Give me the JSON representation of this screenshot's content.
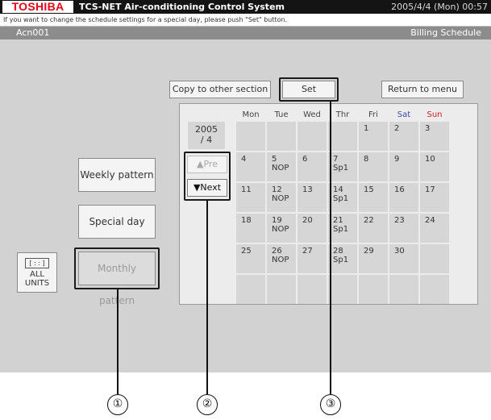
{
  "titlebar": {
    "logo": "TOSHIBA",
    "title": "TCS-NET Air-conditioning Control System",
    "datetime": "2005/4/4 (Mon) 00:57"
  },
  "info_message": "If you want to change the schedule settings for a special day, please push \"Set\" button.",
  "header": {
    "group": "Acn001",
    "screen": "Billing Schedule"
  },
  "toolbar": {
    "copy_label": "Copy to other section",
    "set_label": "Set",
    "return_label": "Return to menu"
  },
  "patterns": {
    "weekly": "Weekly pattern",
    "special": "Special day",
    "monthly": "Monthly pattern"
  },
  "all_units": {
    "icon": "[ : : ]",
    "line1": "ALL",
    "line2": "UNITS"
  },
  "calendar": {
    "year": "2005",
    "month": "/ 4",
    "day_headers": [
      "Mon",
      "Tue",
      "Wed",
      "Thr",
      "Fri",
      "Sat",
      "Sun"
    ],
    "pre_label": "Pre",
    "next_label": "Next",
    "weeks": [
      [
        "",
        "",
        "",
        "",
        "1",
        "2",
        "3"
      ],
      [
        "4",
        "5",
        "6",
        "7",
        "8",
        "9",
        "10"
      ],
      [
        "11",
        "12",
        "13",
        "14",
        "15",
        "16",
        "17"
      ],
      [
        "18",
        "19",
        "20",
        "21",
        "22",
        "23",
        "24"
      ],
      [
        "25",
        "26",
        "27",
        "28",
        "29",
        "30",
        ""
      ],
      [
        "",
        "",
        "",
        "",
        "",
        "",
        ""
      ]
    ],
    "tags": {
      "5": "NOP",
      "7": "Sp1",
      "12": "NOP",
      "14": "Sp1",
      "19": "NOP",
      "21": "Sp1",
      "26": "NOP",
      "28": "Sp1"
    }
  },
  "callouts": [
    "①",
    "②",
    "③"
  ],
  "colors": {
    "brand_red": "#e3001b",
    "saturday": "#3a48b0",
    "sunday": "#d22020"
  }
}
